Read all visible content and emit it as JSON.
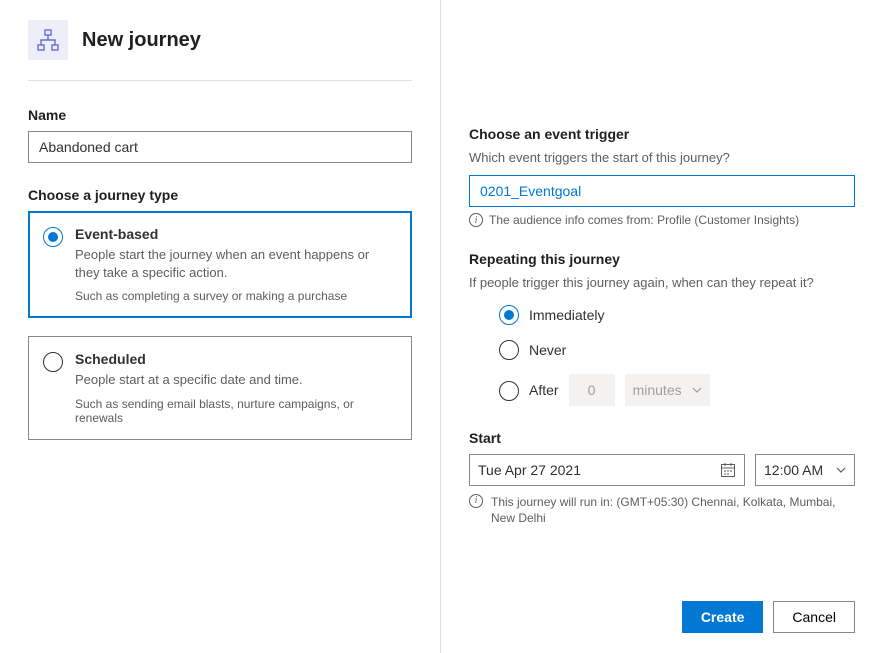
{
  "header": {
    "title": "New journey"
  },
  "name_field": {
    "label": "Name",
    "value": "Abandoned cart"
  },
  "journey_type": {
    "label": "Choose a journey type",
    "options": [
      {
        "title": "Event-based",
        "desc": "People start the journey when an event happens or they take a specific action.",
        "example": "Such as completing a survey or making a purchase"
      },
      {
        "title": "Scheduled",
        "desc": "People start at a specific date and time.",
        "example": "Such as sending email blasts, nurture campaigns, or renewals"
      }
    ]
  },
  "trigger": {
    "label": "Choose an event trigger",
    "sublabel": "Which event triggers the start of this journey?",
    "value": "0201_Eventgoal",
    "info": "The audience info comes from: Profile (Customer Insights)"
  },
  "repeat": {
    "label": "Repeating this journey",
    "sublabel": "If people trigger this journey again, when can they repeat it?",
    "options": {
      "immediately": "Immediately",
      "never": "Never",
      "after": "After"
    },
    "after_value": "0",
    "after_unit": "minutes"
  },
  "start": {
    "label": "Start",
    "date": "Tue Apr 27 2021",
    "time": "12:00 AM",
    "tz": "This journey will run in: (GMT+05:30) Chennai, Kolkata, Mumbai, New Delhi"
  },
  "footer": {
    "create": "Create",
    "cancel": "Cancel"
  }
}
